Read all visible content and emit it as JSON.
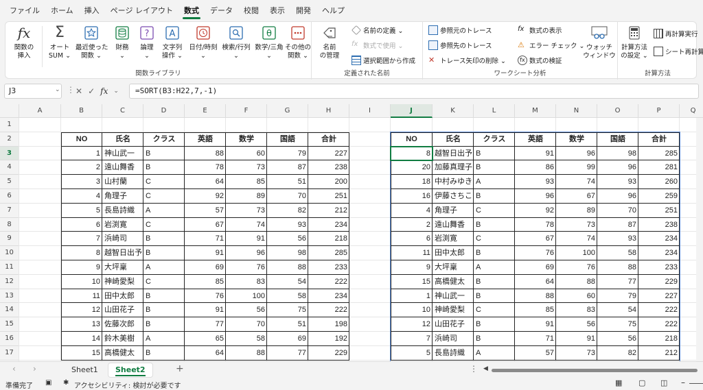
{
  "menu_tabs": [
    "ファイル",
    "ホーム",
    "挿入",
    "ページ レイアウト",
    "数式",
    "データ",
    "校閲",
    "表示",
    "開発",
    "ヘルプ"
  ],
  "active_tab": "数式",
  "ribbon": {
    "insert_function": "関数の\n挿入",
    "autosum": "オート\nSUM ⌄",
    "recent": "最近使った\n関数 ⌄",
    "financial": "財務\n⌄",
    "logical": "論理\n⌄",
    "text": "文字列\n操作 ⌄",
    "datetime": "日付/時刻\n⌄",
    "lookup": "検索/行列\n⌄",
    "math": "数学/三角\n⌄",
    "other": "その他の\n関数 ⌄",
    "group_library": "関数ライブラリ",
    "name_manager": "名前\nの管理",
    "define_name": "名前の定義 ⌄",
    "use_in_formula": "数式で使用 ⌄",
    "create_from_selection": "選択範囲から作成",
    "group_names": "定義された名前",
    "trace_precedents": "参照元のトレース",
    "trace_dependents": "参照先のトレース",
    "remove_arrows": "トレース矢印の削除 ⌄",
    "show_formulas": "数式の表示",
    "error_checking": "エラー チェック ⌄",
    "evaluate_formula": "数式の検証",
    "watch_window": "ウォッチ\nウィンドウ",
    "group_audit": "ワークシート分析",
    "calc_options": "計算方法\nの設定 ⌄",
    "calc_now": "再計算実行",
    "calc_sheet": "シート再計算",
    "group_calc": "計算方法"
  },
  "name_box": "J3",
  "formula": "=SORT(B3:H22,7,-1)",
  "columns": [
    "A",
    "B",
    "C",
    "D",
    "E",
    "F",
    "G",
    "H",
    "I",
    "J",
    "K",
    "L",
    "M",
    "N",
    "O",
    "P",
    "Q"
  ],
  "row_numbers": [
    "1",
    "2",
    "3",
    "4",
    "5",
    "6",
    "7",
    "8",
    "9",
    "10",
    "11",
    "12",
    "13",
    "14",
    "15",
    "16",
    "17"
  ],
  "headers": [
    "NO",
    "氏名",
    "クラス",
    "英語",
    "数学",
    "国語",
    "合計"
  ],
  "left_table": [
    [
      "1",
      "神山武一",
      "B",
      "88",
      "60",
      "79",
      "227"
    ],
    [
      "2",
      "遠山舞香",
      "B",
      "78",
      "73",
      "87",
      "238"
    ],
    [
      "3",
      "山村蘭",
      "C",
      "64",
      "85",
      "51",
      "200"
    ],
    [
      "4",
      "角理子",
      "C",
      "92",
      "89",
      "70",
      "251"
    ],
    [
      "5",
      "長島詩織",
      "A",
      "57",
      "73",
      "82",
      "212"
    ],
    [
      "6",
      "岩渕寛",
      "C",
      "67",
      "74",
      "93",
      "234"
    ],
    [
      "7",
      "浜崎司",
      "B",
      "71",
      "91",
      "56",
      "218"
    ],
    [
      "8",
      "越智日出予",
      "B",
      "91",
      "96",
      "98",
      "285"
    ],
    [
      "9",
      "大坪稟",
      "A",
      "69",
      "76",
      "88",
      "233"
    ],
    [
      "10",
      "神崎愛梨",
      "C",
      "85",
      "83",
      "54",
      "222"
    ],
    [
      "11",
      "田中太郎",
      "B",
      "76",
      "100",
      "58",
      "234"
    ],
    [
      "12",
      "山田花子",
      "B",
      "91",
      "56",
      "75",
      "222"
    ],
    [
      "13",
      "佐藤次郎",
      "B",
      "77",
      "70",
      "51",
      "198"
    ],
    [
      "14",
      "鈴木美樹",
      "A",
      "65",
      "58",
      "69",
      "192"
    ],
    [
      "15",
      "高橋健太",
      "B",
      "64",
      "88",
      "77",
      "229"
    ]
  ],
  "right_table": [
    [
      "8",
      "越智日出予",
      "B",
      "91",
      "96",
      "98",
      "285"
    ],
    [
      "20",
      "加藤真理子",
      "B",
      "86",
      "99",
      "96",
      "281"
    ],
    [
      "18",
      "中村みゆき",
      "A",
      "93",
      "74",
      "93",
      "260"
    ],
    [
      "16",
      "伊藤さちこ",
      "B",
      "96",
      "67",
      "96",
      "259"
    ],
    [
      "4",
      "角理子",
      "C",
      "92",
      "89",
      "70",
      "251"
    ],
    [
      "2",
      "遠山舞香",
      "B",
      "78",
      "73",
      "87",
      "238"
    ],
    [
      "6",
      "岩渕寛",
      "C",
      "67",
      "74",
      "93",
      "234"
    ],
    [
      "11",
      "田中太郎",
      "B",
      "76",
      "100",
      "58",
      "234"
    ],
    [
      "9",
      "大坪稟",
      "A",
      "69",
      "76",
      "88",
      "233"
    ],
    [
      "15",
      "高橋健太",
      "B",
      "64",
      "88",
      "77",
      "229"
    ],
    [
      "1",
      "神山武一",
      "B",
      "88",
      "60",
      "79",
      "227"
    ],
    [
      "10",
      "神崎愛梨",
      "C",
      "85",
      "83",
      "54",
      "222"
    ],
    [
      "12",
      "山田花子",
      "B",
      "91",
      "56",
      "75",
      "222"
    ],
    [
      "7",
      "浜崎司",
      "B",
      "71",
      "91",
      "56",
      "218"
    ],
    [
      "5",
      "長島詩織",
      "A",
      "57",
      "73",
      "82",
      "212"
    ]
  ],
  "sheets": [
    "Sheet1",
    "Sheet2"
  ],
  "active_sheet": "Sheet2",
  "status_ready": "準備完了",
  "status_accessibility": "アクセシビリティ: 検討が必要です",
  "accent_color": "#107c41"
}
